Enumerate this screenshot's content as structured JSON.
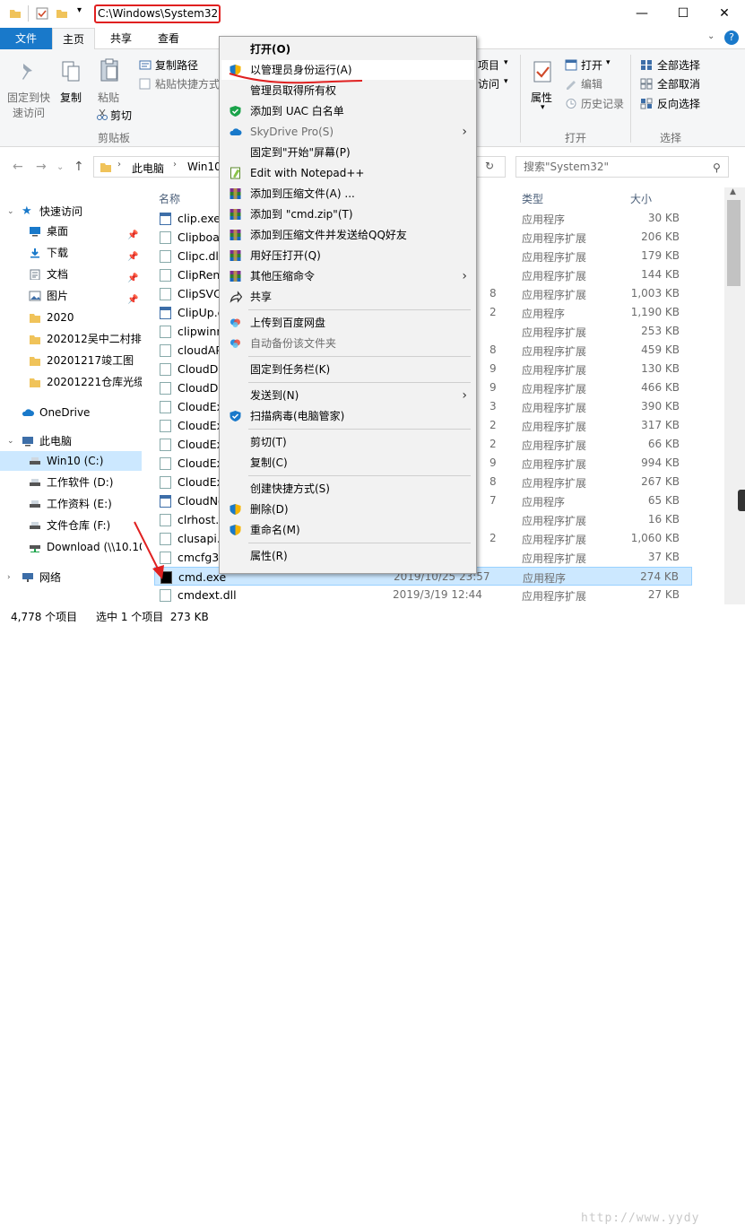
{
  "window": {
    "path_title": "C:\\Windows\\System32",
    "minimize": "—",
    "maximize": "☐",
    "close": "✕"
  },
  "ribbon_tabs": [
    "文件",
    "主页",
    "共享",
    "查看"
  ],
  "ribbon": {
    "pin_quick_access": [
      "固定到快",
      "速访问"
    ],
    "copy": "复制",
    "paste": "粘贴",
    "copy_path": "复制路径",
    "paste_shortcut": "粘贴快捷方式",
    "cut": "剪切",
    "group_clipboard": "剪贴板",
    "new_item_partial": "项目",
    "easy_access_partial": "访问",
    "properties": "属性",
    "open": "打开",
    "edit": "编辑",
    "history": "历史记录",
    "group_open": "打开",
    "select_all": "全部选择",
    "select_none": "全部取消",
    "invert_selection": "反向选择",
    "group_select": "选择"
  },
  "address": {
    "crumbs": [
      "此电脑",
      "Win10"
    ],
    "search_placeholder": "搜索\"System32\""
  },
  "nav": {
    "quick_access": "快速访问",
    "items": [
      {
        "label": "桌面",
        "icon": "desktop-icon"
      },
      {
        "label": "下载",
        "icon": "download-icon"
      },
      {
        "label": "文档",
        "icon": "document-icon"
      },
      {
        "label": "图片",
        "icon": "picture-icon"
      },
      {
        "label": "2020",
        "icon": "folder-icon"
      },
      {
        "label": "202012吴中二村排",
        "icon": "folder-icon"
      },
      {
        "label": "20201217竣工图",
        "icon": "folder-icon"
      },
      {
        "label": "20201221仓库光缆",
        "icon": "folder-icon"
      }
    ],
    "onedrive": "OneDrive",
    "this_pc": "此电脑",
    "drives": [
      {
        "label": "Win10 (C:)"
      },
      {
        "label": "工作软件 (D:)"
      },
      {
        "label": "工作资料 (E:)"
      },
      {
        "label": "文件仓库 (F:)"
      },
      {
        "label": "Download (\\\\10.10"
      }
    ],
    "network": "网络"
  },
  "columns": {
    "name": "名称",
    "type": "类型",
    "size": "大小"
  },
  "files": [
    {
      "name": "clip.exe",
      "date": "",
      "type": "应用程序",
      "size": "30 KB",
      "kind": "exe"
    },
    {
      "name": "Clipboa",
      "date": "",
      "type": "应用程序扩展",
      "size": "206 KB",
      "kind": "dll"
    },
    {
      "name": "Clipc.dll",
      "date": "",
      "type": "应用程序扩展",
      "size": "179 KB",
      "kind": "dll"
    },
    {
      "name": "ClipRen",
      "date": "",
      "type": "应用程序扩展",
      "size": "144 KB",
      "kind": "dll"
    },
    {
      "name": "ClipSVC",
      "date": "8",
      "type": "应用程序扩展",
      "size": "1,003 KB",
      "kind": "dll"
    },
    {
      "name": "ClipUp.e",
      "date": "2",
      "type": "应用程序",
      "size": "1,190 KB",
      "kind": "exe"
    },
    {
      "name": "clipwinr",
      "date": "",
      "type": "应用程序扩展",
      "size": "253 KB",
      "kind": "dll"
    },
    {
      "name": "cloudAP",
      "date": "8",
      "type": "应用程序扩展",
      "size": "459 KB",
      "kind": "dll"
    },
    {
      "name": "CloudDo",
      "date": "9",
      "type": "应用程序扩展",
      "size": "130 KB",
      "kind": "dll"
    },
    {
      "name": "CloudDo",
      "date": "9",
      "type": "应用程序扩展",
      "size": "466 KB",
      "kind": "dll"
    },
    {
      "name": "CloudEx",
      "date": "3",
      "type": "应用程序扩展",
      "size": "390 KB",
      "kind": "dll"
    },
    {
      "name": "CloudEx",
      "date": "2",
      "type": "应用程序扩展",
      "size": "317 KB",
      "kind": "dll"
    },
    {
      "name": "CloudEx",
      "date": "2",
      "type": "应用程序扩展",
      "size": "66 KB",
      "kind": "dll"
    },
    {
      "name": "CloudEx",
      "date": "9",
      "type": "应用程序扩展",
      "size": "994 KB",
      "kind": "dll"
    },
    {
      "name": "CloudEx",
      "date": "8",
      "type": "应用程序扩展",
      "size": "267 KB",
      "kind": "dll"
    },
    {
      "name": "CloudNo",
      "date": "7",
      "type": "应用程序",
      "size": "65 KB",
      "kind": "exe"
    },
    {
      "name": "clrhost.",
      "date": "",
      "type": "应用程序扩展",
      "size": "16 KB",
      "kind": "dll"
    },
    {
      "name": "clusapi.",
      "date": "2",
      "type": "应用程序扩展",
      "size": "1,060 KB",
      "kind": "dll"
    },
    {
      "name": "cmcfg32",
      "date": "",
      "type": "应用程序扩展",
      "size": "37 KB",
      "kind": "dll"
    },
    {
      "name": "cmd.exe",
      "date": "2019/10/25 23:57",
      "type": "应用程序",
      "size": "274 KB",
      "kind": "cmd"
    },
    {
      "name": "cmdext.dll",
      "date": "2019/3/19 12:44",
      "type": "应用程序扩展",
      "size": "27 KB",
      "kind": "dll"
    }
  ],
  "status": {
    "count": "4,778 个项目",
    "selected": "选中 1 个项目  273 KB"
  },
  "context_menu": [
    {
      "label": "打开(O)",
      "bold": true,
      "icon": ""
    },
    {
      "label": "以管理员身份运行(A)",
      "icon": "uac-shield-icon",
      "hl": true
    },
    {
      "label": "管理员取得所有权",
      "icon": ""
    },
    {
      "label": "添加到 UAC 白名单",
      "icon": "green-shield-icon"
    },
    {
      "label": "SkyDrive Pro(S)",
      "icon": "cloud-icon",
      "dim": true,
      "sub": true
    },
    {
      "label": "固定到\"开始\"屏幕(P)",
      "icon": ""
    },
    {
      "label": "Edit with Notepad++",
      "icon": "notepad-icon"
    },
    {
      "label": "添加到压缩文件(A) ...",
      "icon": "winrar-icon"
    },
    {
      "label": "添加到 \"cmd.zip\"(T)",
      "icon": "winrar-icon"
    },
    {
      "label": "添加到压缩文件并发送给QQ好友",
      "icon": "winrar-icon"
    },
    {
      "label": "用好压打开(Q)",
      "icon": "winrar-icon"
    },
    {
      "label": "其他压缩命令",
      "icon": "winrar-icon",
      "sub": true
    },
    {
      "label": "共享",
      "icon": "share-icon"
    },
    {
      "sep": true
    },
    {
      "label": "上传到百度网盘",
      "icon": "baidu-icon"
    },
    {
      "label": "自动备份该文件夹",
      "icon": "baidu-icon",
      "dim": true
    },
    {
      "sep": true
    },
    {
      "label": "固定到任务栏(K)",
      "icon": ""
    },
    {
      "sep": true
    },
    {
      "label": "发送到(N)",
      "icon": "",
      "sub": true
    },
    {
      "label": "扫描病毒(电脑管家)",
      "icon": "tencent-shield-icon"
    },
    {
      "sep": true
    },
    {
      "label": "剪切(T)",
      "icon": ""
    },
    {
      "label": "复制(C)",
      "icon": ""
    },
    {
      "sep": true
    },
    {
      "label": "创建快捷方式(S)",
      "icon": ""
    },
    {
      "label": "删除(D)",
      "icon": "uac-shield-icon"
    },
    {
      "label": "重命名(M)",
      "icon": "uac-shield-icon"
    },
    {
      "sep": true
    },
    {
      "label": "属性(R)",
      "icon": ""
    }
  ],
  "watermark": "http://www.yydy"
}
